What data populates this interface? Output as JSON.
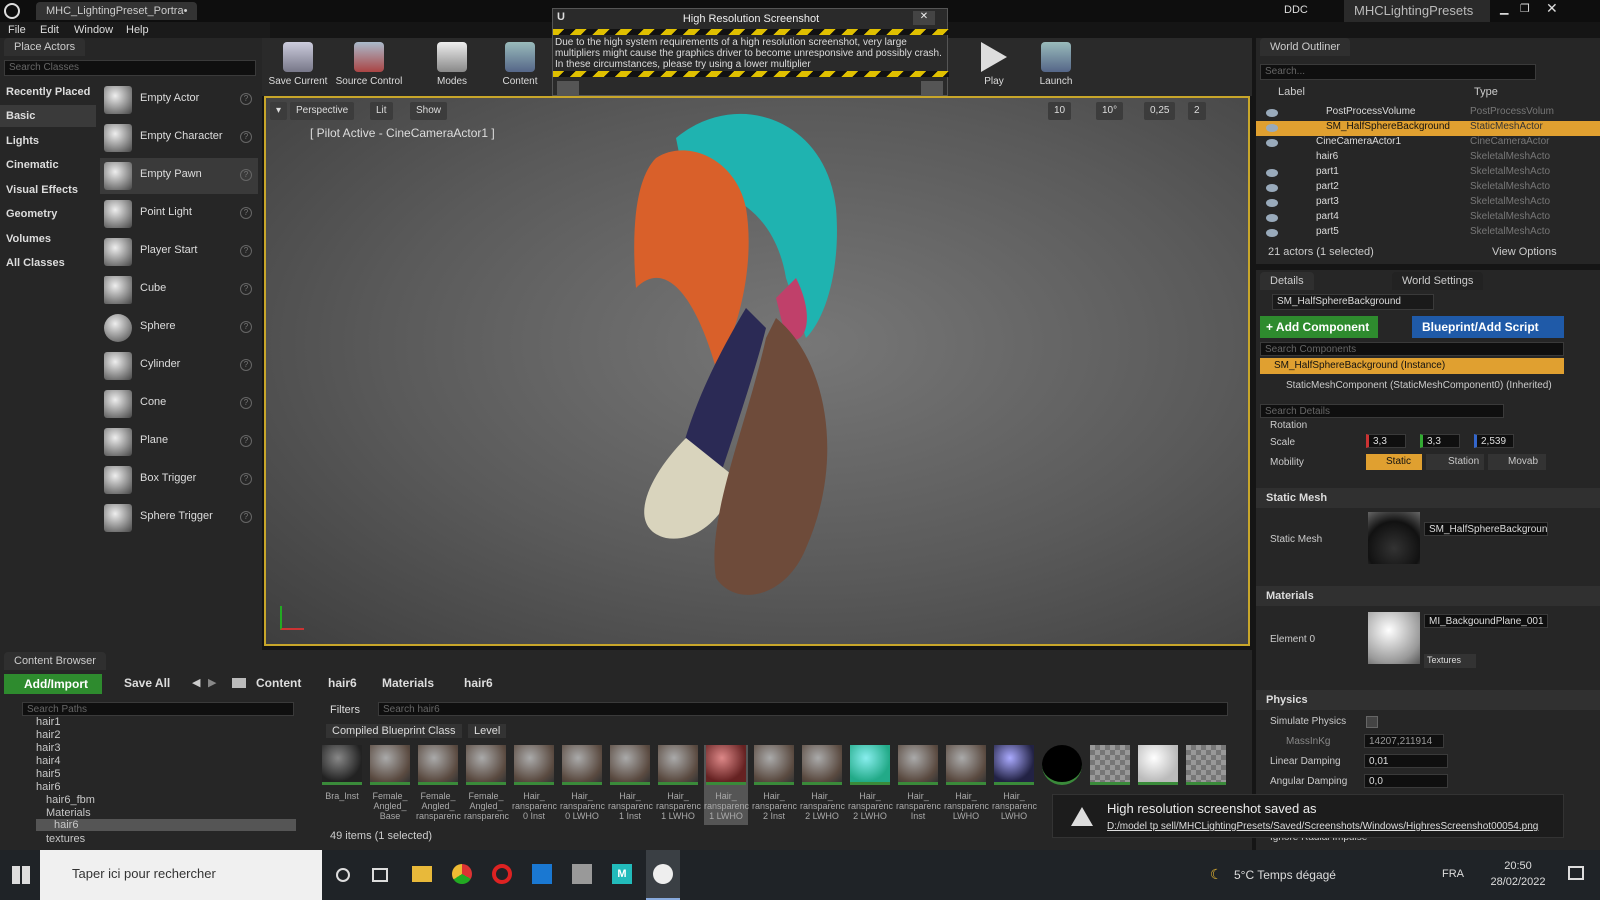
{
  "title_tab": "MHC_LightingPreset_Portra•",
  "menu": [
    "File",
    "Edit",
    "Window",
    "Help"
  ],
  "top_right": {
    "ddc": "DDC",
    "project": "MHCLightingPresets"
  },
  "place_actors": {
    "tab": "Place Actors",
    "search_placeholder": "Search Classes",
    "categories": [
      "Recently Placed",
      "Basic",
      "Lights",
      "Cinematic",
      "Visual Effects",
      "Geometry",
      "Volumes",
      "All Classes"
    ],
    "actors": [
      "Empty Actor",
      "Empty Character",
      "Empty Pawn",
      "Point Light",
      "Player Start",
      "Cube",
      "Sphere",
      "Cylinder",
      "Cone",
      "Plane",
      "Box Trigger",
      "Sphere Trigger"
    ]
  },
  "toolbar": {
    "save": "Save Current",
    "source": "Source Control",
    "modes": "Modes",
    "content": "Content",
    "play": "Play",
    "launch": "Launch"
  },
  "popup": {
    "title": "High Resolution Screenshot",
    "text": "Due to the high system requirements of a high resolution screenshot, very large multipliers might cause the graphics driver to become unresponsive and possibly crash. In these circumstances, please try using a lower multiplier"
  },
  "viewport": {
    "perspective": "Perspective",
    "lit": "Lit",
    "show": "Show",
    "pilot": "[ Pilot Active - CineCameraActor1 ]",
    "grid": "10",
    "angle": "10°",
    "scale": "0,25",
    "cam": "2"
  },
  "outliner": {
    "tab": "World Outliner",
    "search_placeholder": "Search...",
    "col_label": "Label",
    "col_type": "Type",
    "rows": [
      {
        "n": "PostProcessVolume",
        "t": "PostProcessVolum"
      },
      {
        "n": "SM_HalfSphereBackground",
        "t": "StaticMeshActor"
      },
      {
        "n": "CineCameraActor1",
        "t": "CineCameraActor"
      },
      {
        "n": "hair6",
        "t": "SkeletalMeshActo"
      },
      {
        "n": "part1",
        "t": "SkeletalMeshActo"
      },
      {
        "n": "part2",
        "t": "SkeletalMeshActo"
      },
      {
        "n": "part3",
        "t": "SkeletalMeshActo"
      },
      {
        "n": "part4",
        "t": "SkeletalMeshActo"
      },
      {
        "n": "part5",
        "t": "SkeletalMeshActo"
      }
    ],
    "count": "21 actors (1 selected)",
    "view_options": "View Options"
  },
  "details": {
    "tab": "Details",
    "world_settings": "World Settings",
    "name": "SM_HalfSphereBackground",
    "add_component": "+ Add Component",
    "blueprint": "Blueprint/Add Script",
    "search_components": "Search Components",
    "instance": "SM_HalfSphereBackground (Instance)",
    "component": "StaticMeshComponent (StaticMeshComponent0) (Inherited)",
    "search_details": "Search Details",
    "rotation": "Rotation",
    "scale": "Scale",
    "sx": "3,3",
    "sy": "3,3",
    "sz": "2,539",
    "mobility": "Mobility",
    "static": "Static",
    "station": "Station",
    "movab": "Movab",
    "static_mesh_section": "Static Mesh",
    "static_mesh_label": "Static Mesh",
    "mesh_value": "SM_HalfSphereBackgroun",
    "materials_section": "Materials",
    "element0": "Element 0",
    "material_value": "MI_BackgoundPlane_001",
    "textures": "Textures",
    "physics_section": "Physics",
    "simulate": "Simulate Physics",
    "mass": "MassInKg",
    "mass_value": "14207,211914",
    "linear": "Linear Damping",
    "linear_value": "0,01",
    "angular": "Angular Damping",
    "angular_value": "0,0",
    "ignore": "Ignore Radial Impulse"
  },
  "content_browser": {
    "tab": "Content Browser",
    "add": "Add/Import",
    "save_all": "Save All",
    "path": [
      "Content",
      "hair6",
      "Materials",
      "hair6"
    ],
    "search_paths": "Search Paths",
    "filters": "Filters",
    "search_asset": "Search hair6",
    "filter_tags": [
      "Compiled Blueprint Class",
      "Level"
    ],
    "tree": [
      "hair1",
      "hair2",
      "hair3",
      "hair4",
      "hair5",
      "hair6",
      "hair6_fbm",
      "Materials",
      "hair6",
      "textures"
    ],
    "assets": [
      "Bra_Inst",
      "Female_ Angled_ Base",
      "Female_ Angled_ ransparenc",
      "Female_ Angled_ ransparenc",
      "Hair_ ransparenc 0 Inst",
      "Hair_ ransparenc 0 LWHO",
      "Hair_ ransparenc 1 Inst",
      "Hair_ ransparenc 1 LWHO",
      "Hair_ ransparenc 1 LWHO",
      "Hair_ ransparenc 2 Inst",
      "Hair_ ransparenc 2 LWHO",
      "Hair_ ransparenc 2 LWHO",
      "Hair_ ransparenc Inst",
      "Hair_ ransparenc LWHO",
      "Hair_ ransparenc LWHO"
    ],
    "count": "49 items (1 selected)"
  },
  "notification": {
    "title": "High resolution screenshot saved as",
    "path": "D:/model tp sell/MHCLightingPresets/Saved/Screenshots/Windows/HighresScreenshot00054.png"
  },
  "taskbar": {
    "search": "Taper ici pour rechercher",
    "weather": "5°C  Temps dégagé",
    "lang": "FRA",
    "time": "20:50",
    "date": "28/02/2022"
  }
}
